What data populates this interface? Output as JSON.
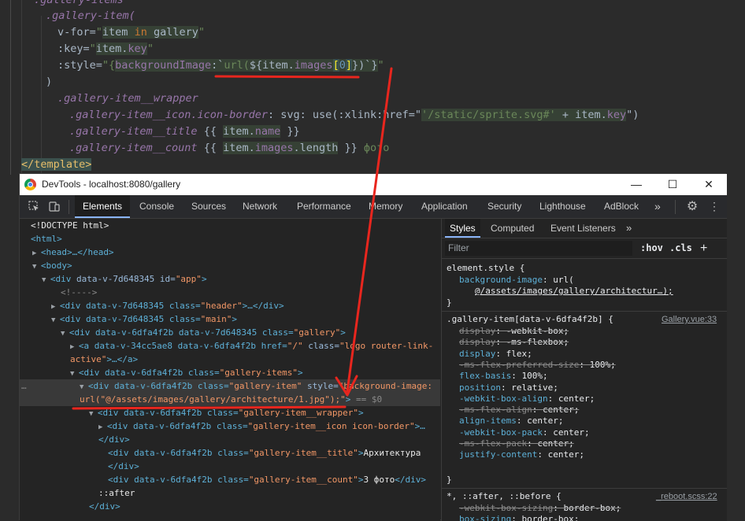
{
  "editor": {
    "line0": ".gallery-items",
    "line1": ".gallery-item(",
    "line2_attr": "v-for=",
    "line2_q1": "\"",
    "line2_var1": "item",
    "line2_in": " in ",
    "line2_var2": "gallery",
    "line2_q2": "\"",
    "line3_attr": ":key=",
    "line3_q1": "\"",
    "line3_expr": "item.",
    "line3_prop": "key",
    "line3_q2": "\"",
    "line4_attr": ":style=",
    "line4_open": "\"{",
    "line4_key": "backgroundImage",
    "line4_colon": ":`",
    "line4_url": "url(",
    "line4_expr": "${item.",
    "line4_images": "images",
    "line4_bopen": "[",
    "line4_idx": "0",
    "line4_bclose": "]",
    "line4_cb": "})`}",
    "line4_q": "\"",
    "line5": ")",
    "line6": ".gallery-item__wrapper",
    "line7_sel": ".gallery-item__icon.icon-border",
    "line7_rest": ": svg: use(:xlink:href=\"",
    "line7_str": "'/static/sprite.svg#'",
    "line7_plus": " + item.",
    "line7_key": "key",
    "line7_end": "\")",
    "line8_sel": ".gallery-item__title",
    "line8_open": " {{ ",
    "line8_expr": "item.",
    "line8_name": "name",
    "line8_close": " }}",
    "line9_sel": ".gallery-item__count",
    "line9_open": " {{ ",
    "line9_expr": "item.",
    "line9_images": "images",
    "line9_len": ".length",
    "line9_close": " }}",
    "line9_text": " фото",
    "line10": "</template>"
  },
  "window": {
    "title": "DevTools - localhost:8080/gallery",
    "minimize": "—",
    "maximize": "☐",
    "close": "✕"
  },
  "tabs": [
    "Elements",
    "Console",
    "Sources",
    "Network",
    "Performance",
    "Memory",
    "Application",
    "Security",
    "Lighthouse",
    "AdBlock",
    "»"
  ],
  "dom": {
    "doctype": "<!DOCTYPE html>",
    "html": "<html>",
    "head": "<head>…</head>",
    "body": "<body>",
    "app_tag": "<div ",
    "app_attr": "data-v-7d648345 id=",
    "app_val": "\"app\"",
    "app_end": ">",
    "comment": "<!---->",
    "header_attr": "<div data-v-7d648345 class=",
    "header_val": "\"header\"",
    "header_end": ">…</div>",
    "main_attr": "<div data-v-7d648345 class=",
    "main_val": "\"main\"",
    "main_end": ">",
    "gallery_attr": "<div data-v-6dfa4f2b data-v-7d648345 class=",
    "gallery_val": "\"gallery\"",
    "gallery_end": ">",
    "logo_attr": "<a data-v-34cc5ae8 data-v-6dfa4f2b href=",
    "logo_href": "\"/\"",
    "logo_class": " class=",
    "logo_val": "\"logo router-link-",
    "logo_val2": "active\"",
    "logo_end": ">…</a>",
    "items_attr": "<div data-v-6dfa4f2b class=",
    "items_val": "\"gallery-items\"",
    "items_end": ">",
    "item_attr": "<div data-v-6dfa4f2b class=",
    "item_val": "\"gallery-item\"",
    "item_style": " style=",
    "item_style_val1": "\"background-image:",
    "item_style_val2": "url(\"@/assets/images/gallery/architecture/1.jpg\");\"",
    "item_end": ">",
    "item_eq": " == $0",
    "wrapper_attr": "<div data-v-6dfa4f2b class=",
    "wrapper_val": "\"gallery-item__wrapper\"",
    "wrapper_end": ">",
    "icon_attr": "<div data-v-6dfa4f2b class=",
    "icon_val": "\"gallery-item__icon icon-border\"",
    "icon_end": ">…",
    "close_div": "</div>",
    "title_attr": "<div data-v-6dfa4f2b class=",
    "title_val": "\"gallery-item__title\"",
    "title_end": ">",
    "title_text": "Архитектура",
    "count_attr": "<div data-v-6dfa4f2b class=",
    "count_val": "\"gallery-item__count\"",
    "count_end": ">",
    "count_text": "3 фото",
    "count_close": "</div>",
    "after": "::after",
    "close_div2": "</div>",
    "dots": "…"
  },
  "styles": {
    "subtabs": [
      "Styles",
      "Computed",
      "Event Listeners",
      "»"
    ],
    "filter_placeholder": "Filter",
    "hov": ":hov",
    "cls": ".cls",
    "plus": "+",
    "element_style": "element.style {",
    "bg_prop": "background-image",
    "bg_val1": ": url(",
    "bg_val2": "@/assets/images/gallery/architectur…);",
    "close": "}",
    "rule1_sel": ".gallery-item[data-v-6dfa4f2b] {",
    "rule1_src": "Gallery.vue:33",
    "rule1": [
      {
        "p": "display",
        "v": ": -webkit-box;",
        "struck": true
      },
      {
        "p": "display",
        "v": ": -ms-flexbox;",
        "struck": true
      },
      {
        "p": "display",
        "v": ": flex;",
        "struck": false
      },
      {
        "p": "-ms-flex-preferred-size",
        "v": ": 100%;",
        "struck": true
      },
      {
        "p": "flex-basis",
        "v": ": 100%;",
        "struck": false
      },
      {
        "p": "position",
        "v": ": relative;",
        "struck": false
      },
      {
        "p": "-webkit-box-align",
        "v": ": center;",
        "struck": false
      },
      {
        "p": "-ms-flex-align",
        "v": ": center;",
        "struck": true
      },
      {
        "p": "align-items",
        "v": ": center;",
        "struck": false
      },
      {
        "p": "-webkit-box-pack",
        "v": ": center;",
        "struck": false
      },
      {
        "p": "-ms-flex-pack",
        "v": ": center;",
        "struck": true
      },
      {
        "p": "justify-content",
        "v": ": center;",
        "struck": false
      }
    ],
    "rule2_sel": "*, ::after, ::before {",
    "rule2_src": "_reboot.scss:22",
    "rule2": [
      {
        "p": "-webkit-box-sizing",
        "v": ": border-box;",
        "struck": true
      },
      {
        "p": "box-sizing",
        "v": ": border-box;",
        "struck": false
      }
    ]
  },
  "annotation_color": "#e8261e"
}
